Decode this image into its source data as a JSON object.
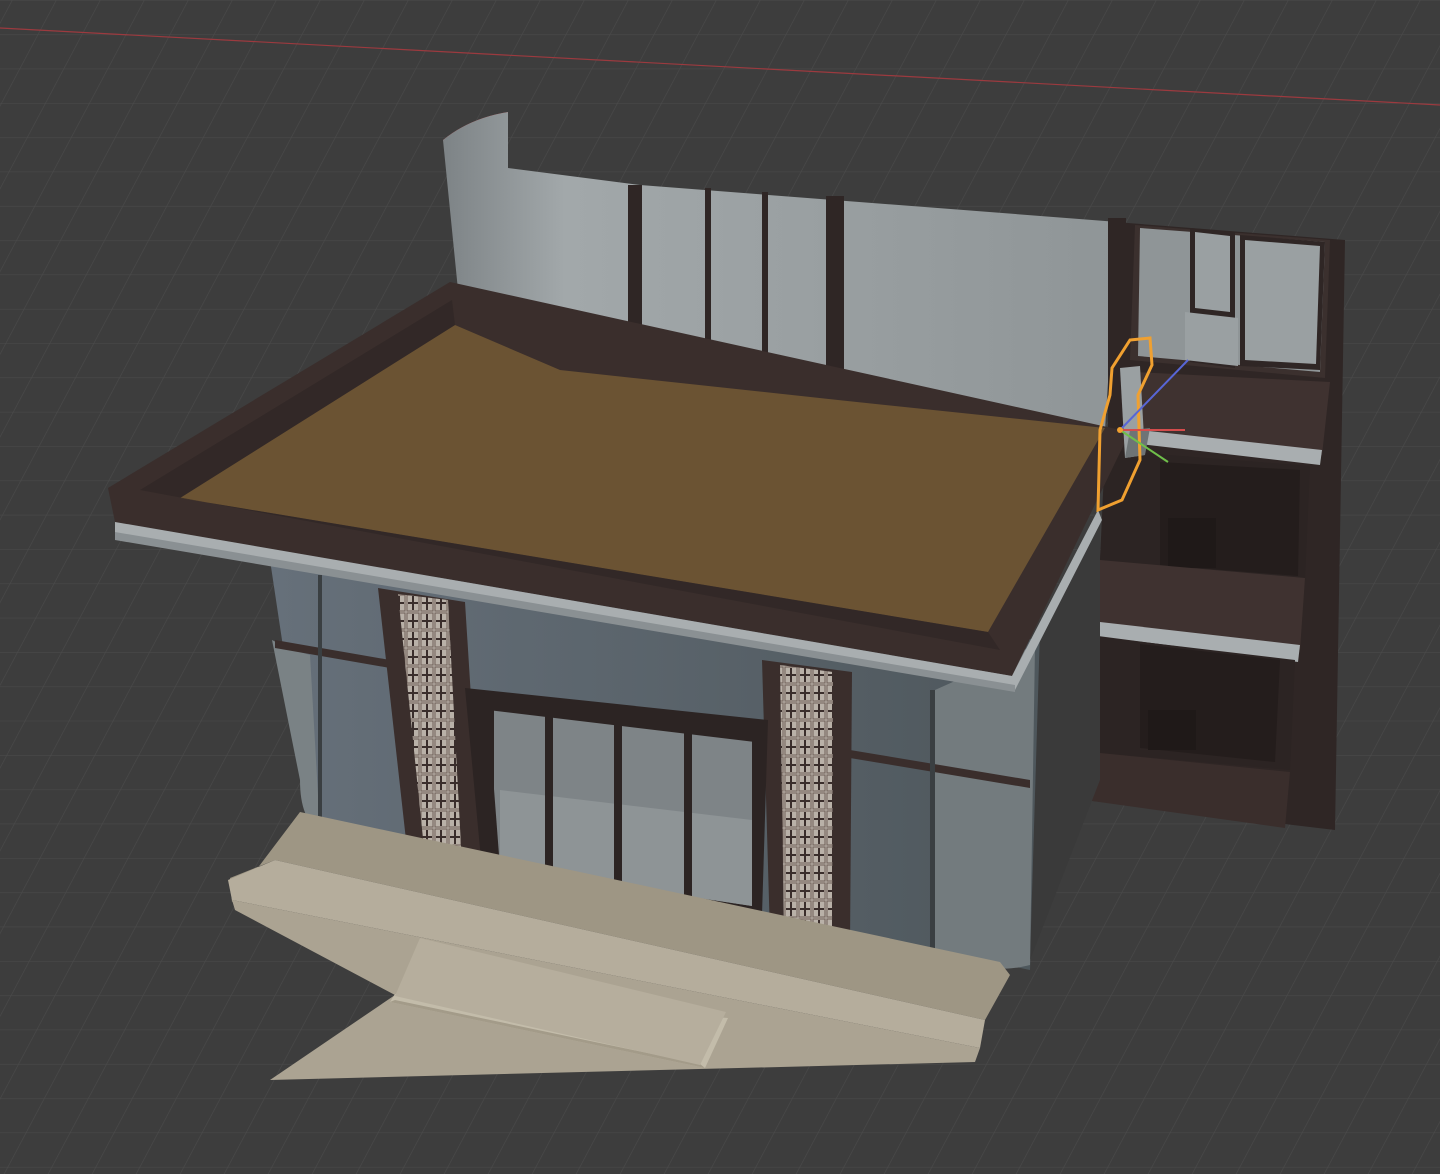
{
  "viewport": {
    "background_color": "#3d3d3d",
    "grid_color": "#4a4a4a",
    "x_axis_color": "#b5343f"
  },
  "model": {
    "roof_color": "#6b5333",
    "trim_color": "#3a2e2c",
    "wall_color": "#8c9294",
    "glass_color": "#5a6367",
    "plinth_color": "#a59d8c",
    "back_face_color": "#d42a2a"
  },
  "selection": {
    "outline_color": "#f0a030",
    "gizmo_axes": [
      "x-axis",
      "y-axis",
      "z-axis"
    ]
  }
}
